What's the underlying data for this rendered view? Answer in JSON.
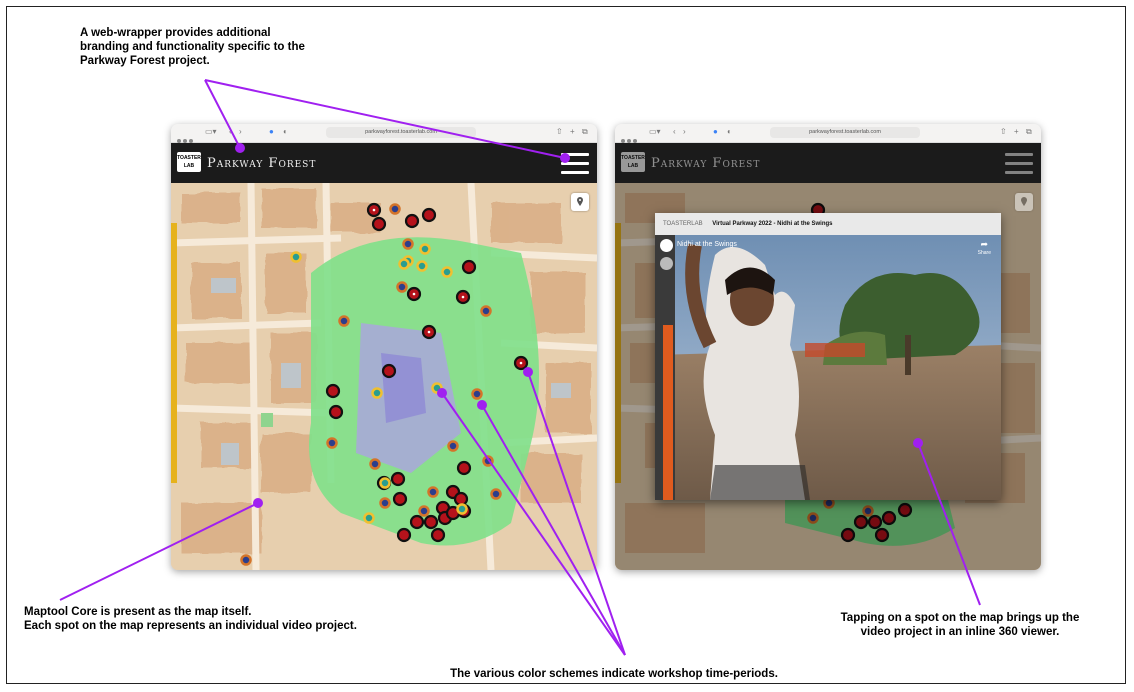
{
  "annotations": {
    "wrapper": "A web-wrapper provides additional branding and functionality specific to the Parkway Forest project.",
    "maptool_line1": "Maptool Core is present as the map itself.",
    "maptool_line2": "Each spot on the map represents an individual video project.",
    "tapping_line1": "Tapping on a spot on the map brings up the",
    "tapping_line2": "video project in an inline 360 viewer.",
    "colors": "The various color schemes indicate workshop time-periods."
  },
  "browser_left": {
    "url": "parkwayforest.toasterlab.com",
    "logo_text_top": "TOASTER",
    "logo_text_bottom": "LAB",
    "brand": "Parkway Forest"
  },
  "browser_right": {
    "url": "parkwayforest.toasterlab.com",
    "logo_text_top": "TOASTER",
    "logo_text_bottom": "LAB",
    "brand": "Parkway Forest",
    "viewer_source": "TOASTERLAB",
    "viewer_title": "Virtual Parkway 2022 - Nidhi at the Swings",
    "video_label": "Nidhi at the Swings",
    "share_label": "Share"
  },
  "colors": {
    "annotation_line": "#a020f0",
    "spot_red": "#b5121b",
    "spot_orange_ring": "#d4742a",
    "spot_blue_center": "#2c3e8c",
    "spot_yellow_ring": "#f0c030",
    "spot_teal_center": "#2a9d8f"
  }
}
